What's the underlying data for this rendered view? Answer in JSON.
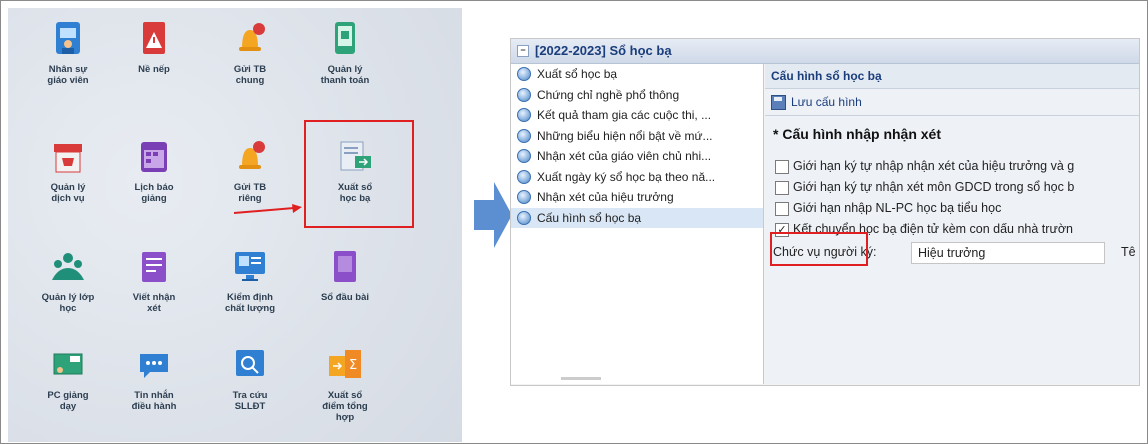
{
  "left_panel": {
    "tiles": [
      {
        "label": "Nhân sự\ngiáo viên",
        "icon": "teacher-icon"
      },
      {
        "label": "Nề nếp",
        "icon": "warning-icon"
      },
      {
        "label": "Gửi TB\nchung",
        "icon": "bell-icon"
      },
      {
        "label": "Quản lý\nthanh toán",
        "icon": "payment-phone-icon"
      },
      {
        "label": "Quản lý\ndịch vụ",
        "icon": "store-icon"
      },
      {
        "label": "Lịch báo\ngiảng",
        "icon": "calendar-icon"
      },
      {
        "label": "Gửi TB\nriêng",
        "icon": "bell-icon"
      },
      {
        "label": "Xuất sổ\nhọc bạ",
        "icon": "export-document-icon"
      },
      {
        "label": "Quản lý lớp\nhọc",
        "icon": "class-group-icon"
      },
      {
        "label": "Viết nhận\nxét",
        "icon": "write-comment-icon"
      },
      {
        "label": "Kiểm định\nchất lượng",
        "icon": "monitor-icon"
      },
      {
        "label": "Sổ đầu bài",
        "icon": "book-icon"
      },
      {
        "label": "PC giảng\ndạy",
        "icon": "blackboard-icon"
      },
      {
        "label": "Tin nhắn\nđiều hành",
        "icon": "chat-icon"
      },
      {
        "label": "Tra cứu\nSLLĐT",
        "icon": "search-monitor-icon"
      },
      {
        "label": "Xuất sổ\nđiểm tổng\nhợp",
        "icon": "sum-export-icon"
      }
    ]
  },
  "right_panel": {
    "title": "[2022-2023] Sổ học bạ",
    "menu": [
      "Xuất sổ học bạ",
      "Chứng chỉ nghề phổ thông",
      "Kết quả tham gia các cuộc thi, ...",
      "Những biểu hiện nổi bật về mứ...",
      "Nhận xét của giáo viên chủ nhi...",
      "Xuất ngày ký sổ học bạ theo nă...",
      "Nhận xét của hiệu trưởng",
      "Cấu hình sổ học bạ"
    ],
    "config_title": "Cấu hình sổ học bạ",
    "save_label": "Lưu cấu hình",
    "section_title": "* Cấu hình nhập nhận xét",
    "options": [
      {
        "label": "Giới hạn ký tự nhập nhận xét của hiệu trưởng và g",
        "checked": false
      },
      {
        "label": "Giới hạn ký tự nhận xét môn GDCD trong sổ học b",
        "checked": false
      },
      {
        "label": "Giới hạn nhập NL-PC học bạ tiểu học",
        "checked": false
      },
      {
        "label": "Kết chuyển học bạ điện tử kèm con dấu nhà trườn",
        "checked": true
      }
    ],
    "signer_label": "Chức vụ người ký:",
    "signer_value": "Hiệu trưởng",
    "signer_extra": "Tê"
  },
  "colors": {
    "highlight": "#e02020",
    "arrow": "#5b8fd1",
    "title": "#1a3d7c"
  }
}
